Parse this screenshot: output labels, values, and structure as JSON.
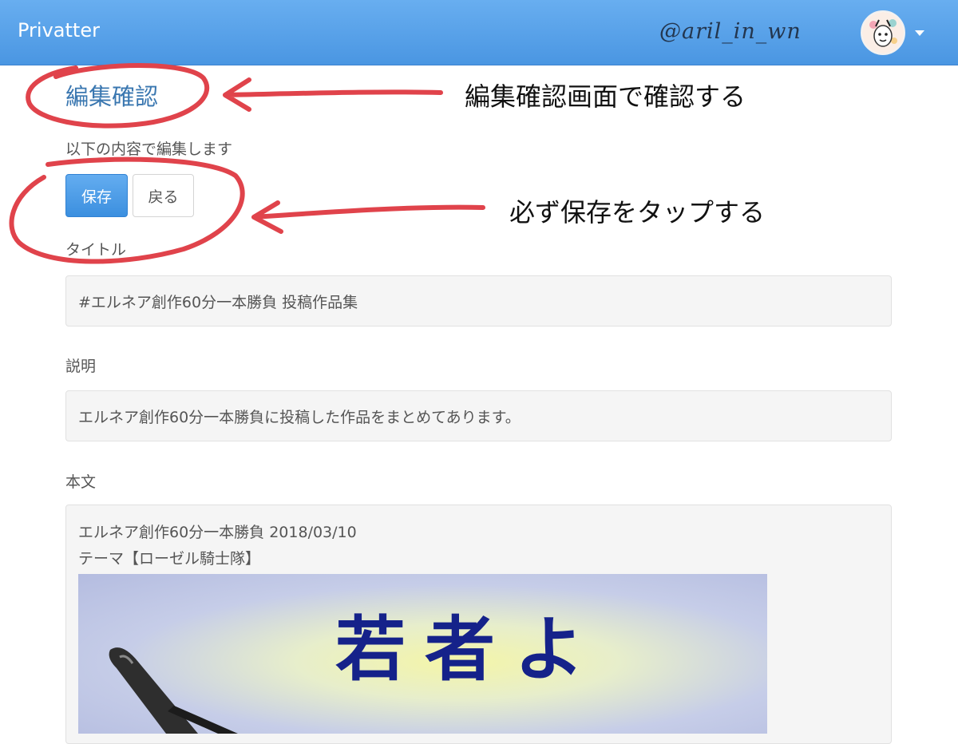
{
  "navbar": {
    "brand": "Privatter",
    "handle": "@aril_in_wn"
  },
  "page": {
    "title": "編集確認",
    "subtitle": "以下の内容で編集します"
  },
  "actions": {
    "save_label": "保存",
    "back_label": "戻る"
  },
  "fields": {
    "title_label": "タイトル",
    "title_value": "#エルネア創作60分一本勝負 投稿作品集",
    "description_label": "説明",
    "description_value": "エルネア創作60分一本勝負に投稿した作品をまとめてあります。",
    "body_label": "本文",
    "body_lines": [
      "エルネア創作60分一本勝負 2018/03/10",
      "テーマ【ローゼル騎士隊】"
    ],
    "embedded_image_text": "若者よ"
  },
  "annotations": {
    "confirm_note": "編集確認画面で確認する",
    "save_note": "必ず保存をタップする",
    "color": "#e0434b"
  },
  "colors": {
    "navbar": "#4a96e2",
    "primary_button": "#3b8fdf",
    "title_link": "#3a77b0",
    "image_text": "#15228a"
  }
}
